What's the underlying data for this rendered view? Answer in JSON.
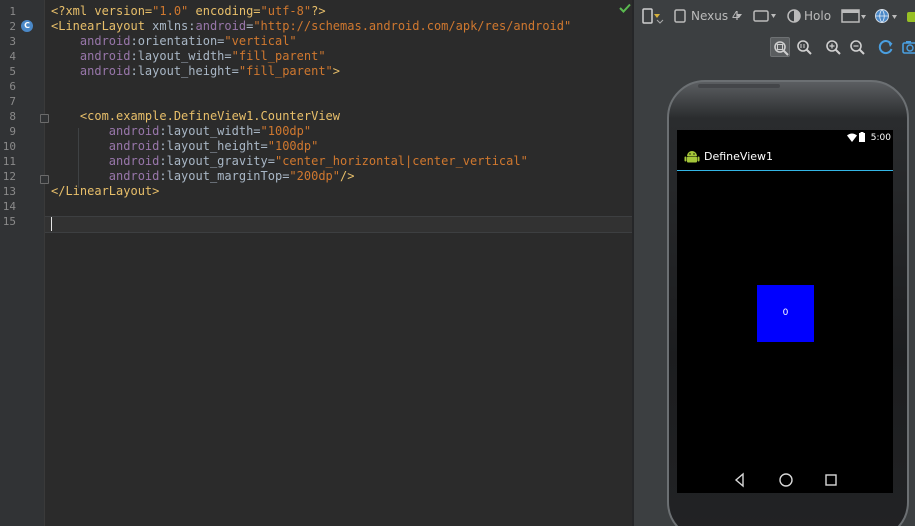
{
  "editor": {
    "line_numbers": [
      "1",
      "2",
      "3",
      "4",
      "5",
      "6",
      "7",
      "8",
      "9",
      "10",
      "11",
      "12",
      "13",
      "14",
      "15"
    ],
    "lines": [
      [
        {
          "t": "<?xml version=",
          "c": "t-prolog"
        },
        {
          "t": "\"1.0\"",
          "c": "t-str"
        },
        {
          "t": " encoding=",
          "c": "t-prolog"
        },
        {
          "t": "\"utf-8\"",
          "c": "t-str"
        },
        {
          "t": "?>",
          "c": "t-prolog"
        }
      ],
      [
        {
          "t": "<LinearLayout ",
          "c": "t-tag"
        },
        {
          "t": "xmlns:",
          "c": "t-pl"
        },
        {
          "t": "android",
          "c": "t-ns"
        },
        {
          "t": "=",
          "c": "t-pl"
        },
        {
          "t": "\"http://schemas.android.com/apk/res/android\"",
          "c": "t-str"
        }
      ],
      [
        {
          "t": "    ",
          "c": "t-pl"
        },
        {
          "t": "android",
          "c": "t-ns"
        },
        {
          "t": ":orientation=",
          "c": "t-pl"
        },
        {
          "t": "\"vertical\"",
          "c": "t-str"
        }
      ],
      [
        {
          "t": "    ",
          "c": "t-pl"
        },
        {
          "t": "android",
          "c": "t-ns"
        },
        {
          "t": ":layout_width=",
          "c": "t-pl"
        },
        {
          "t": "\"fill_parent\"",
          "c": "t-str"
        }
      ],
      [
        {
          "t": "    ",
          "c": "t-pl"
        },
        {
          "t": "android",
          "c": "t-ns"
        },
        {
          "t": ":layout_height=",
          "c": "t-pl"
        },
        {
          "t": "\"fill_parent\"",
          "c": "t-str"
        },
        {
          "t": ">",
          "c": "t-tag"
        }
      ],
      [],
      [],
      [
        {
          "t": "    ",
          "c": "t-pl"
        },
        {
          "t": "<com.example.DefineView1.CounterView",
          "c": "t-tag"
        }
      ],
      [
        {
          "t": "        ",
          "c": "t-pl"
        },
        {
          "t": "android",
          "c": "t-ns"
        },
        {
          "t": ":layout_width=",
          "c": "t-pl"
        },
        {
          "t": "\"100dp\"",
          "c": "t-str"
        }
      ],
      [
        {
          "t": "        ",
          "c": "t-pl"
        },
        {
          "t": "android",
          "c": "t-ns"
        },
        {
          "t": ":layout_height=",
          "c": "t-pl"
        },
        {
          "t": "\"100dp\"",
          "c": "t-str"
        }
      ],
      [
        {
          "t": "        ",
          "c": "t-pl"
        },
        {
          "t": "android",
          "c": "t-ns"
        },
        {
          "t": ":layout_gravity=",
          "c": "t-pl"
        },
        {
          "t": "\"center_horizontal|center_vertical\"",
          "c": "t-str"
        }
      ],
      [
        {
          "t": "        ",
          "c": "t-pl"
        },
        {
          "t": "android",
          "c": "t-ns"
        },
        {
          "t": ":layout_marginTop=",
          "c": "t-pl"
        },
        {
          "t": "\"200dp\"",
          "c": "t-str"
        },
        {
          "t": "/>",
          "c": "t-tag"
        }
      ],
      [
        {
          "t": "</LinearLayout>",
          "c": "t-tag"
        }
      ],
      [],
      []
    ],
    "gutter_badge": "C"
  },
  "designer": {
    "device_label": "Nexus 4",
    "theme_label": "Holo"
  },
  "preview": {
    "clock": "5:00",
    "app_title": "DefineView1",
    "counter_value": "0"
  },
  "colors": {
    "counter_bg": "#0000ff",
    "accent": "#33b5e5",
    "ok_check": "#5ab94f"
  }
}
